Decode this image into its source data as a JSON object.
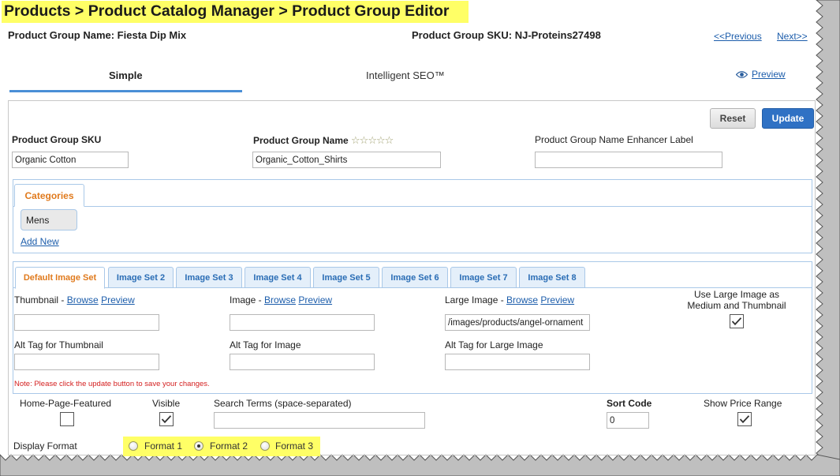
{
  "breadcrumb": "Products > Product Catalog Manager > Product Group Editor",
  "header": {
    "group_name_label": "Product Group Name: Fiesta Dip Mix",
    "sku_label": "Product Group SKU: NJ-Proteins27498",
    "previous": "<<Previous",
    "next": "Next>>"
  },
  "tabs": {
    "simple": "Simple",
    "seo": "Intelligent SEO™",
    "preview": "Preview"
  },
  "buttons": {
    "reset": "Reset",
    "update": "Update"
  },
  "fields": {
    "sku_label": "Product Group SKU",
    "sku_value": "Organic Cotton",
    "name_label": "Product Group Name",
    "name_value": "Organic_Cotton_Shirts",
    "stars": "☆☆☆☆☆",
    "enhancer_label": "Product Group Name Enhancer Label",
    "enhancer_value": ""
  },
  "categories": {
    "tab": "Categories",
    "items": [
      "Mens"
    ],
    "add_new": "Add New"
  },
  "image_sets": {
    "tabs": [
      "Default Image Set",
      "Image Set 2",
      "Image Set 3",
      "Image Set 4",
      "Image Set 5",
      "Image Set 6",
      "Image Set 7",
      "Image Set 8"
    ],
    "browse": "Browse",
    "preview": "Preview",
    "thumbnail_label": "Thumbnail - ",
    "image_label": "Image - ",
    "large_label": "Large Image - ",
    "thumbnail_value": "",
    "image_value": "",
    "large_value": "/images/products/angel-ornament",
    "use_large_label_1": "Use Large Image as",
    "use_large_label_2": "Medium and Thumbnail",
    "use_large_checked": true,
    "alt_thumb_label": "Alt Tag for Thumbnail",
    "alt_image_label": "Alt Tag for Image",
    "alt_large_label": "Alt Tag for Large Image",
    "note": "Note: Please click the update button to save your changes."
  },
  "options": {
    "home_featured_label": "Home-Page-Featured",
    "home_featured_checked": false,
    "visible_label": "Visible",
    "visible_checked": true,
    "search_terms_label": "Search Terms (space-separated)",
    "search_terms_value": "",
    "sort_code_label": "Sort Code",
    "sort_code_value": "0",
    "show_price_label": "Show Price Range",
    "show_price_checked": true
  },
  "display_format": {
    "label": "Display Format",
    "options": [
      "Format 1",
      "Format 2",
      "Format 3"
    ],
    "selected": "Format 2"
  },
  "colors": {
    "highlight": "#ffff66",
    "accent_blue": "#2f71c4",
    "tab_orange": "#e07a1d",
    "link": "#1c5dab"
  }
}
